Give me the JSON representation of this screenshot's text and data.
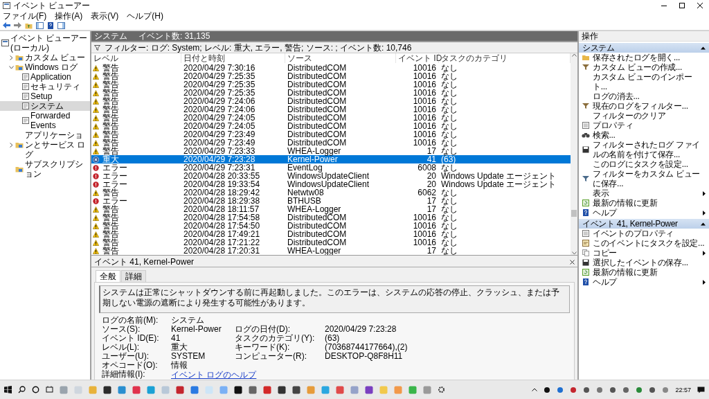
{
  "window": {
    "title": "イベント ビューアー"
  },
  "menu": [
    "ファイル(F)",
    "操作(A)",
    "表示(V)",
    "ヘルプ(H)"
  ],
  "tree": [
    {
      "label": "イベント ビューアー (ローカル)",
      "kind": "root",
      "selected": false,
      "children": [
        {
          "label": "カスタム ビュー",
          "kind": "folder",
          "expanded": false,
          "selected": false
        },
        {
          "label": "Windows ログ",
          "kind": "folder",
          "expanded": true,
          "selected": false,
          "children": [
            {
              "label": "Application",
              "kind": "log",
              "selected": false
            },
            {
              "label": "セキュリティ",
              "kind": "log",
              "selected": false
            },
            {
              "label": "Setup",
              "kind": "log",
              "selected": false
            },
            {
              "label": "システム",
              "kind": "log",
              "selected": true
            },
            {
              "label": "Forwarded Events",
              "kind": "log",
              "selected": false
            }
          ]
        },
        {
          "label": "アプリケーションとサービス ログ",
          "kind": "folder",
          "expanded": false,
          "selected": false
        },
        {
          "label": "サブスクリプション",
          "kind": "folder",
          "selected": false
        }
      ]
    }
  ],
  "log_header": {
    "title": "システム",
    "count": "イベント数: 31,135"
  },
  "filter": "フィルター: ログ: System; レベル: 重大, エラー, 警告; ソース: ; イベント数: 10,746",
  "table": {
    "columns": [
      "レベル",
      "日付と時刻",
      "ソース",
      "イベント ID",
      "タスクのカテゴリ"
    ],
    "rows": [
      {
        "kind": "warning",
        "level": "警告",
        "datetime": "2020/04/29 7:30:16",
        "source": "DistributedCOM",
        "event_id": "10016",
        "category": "なし",
        "selected": false
      },
      {
        "kind": "warning",
        "level": "警告",
        "datetime": "2020/04/29 7:25:35",
        "source": "DistributedCOM",
        "event_id": "10016",
        "category": "なし",
        "selected": false
      },
      {
        "kind": "warning",
        "level": "警告",
        "datetime": "2020/04/29 7:25:35",
        "source": "DistributedCOM",
        "event_id": "10016",
        "category": "なし",
        "selected": false
      },
      {
        "kind": "warning",
        "level": "警告",
        "datetime": "2020/04/29 7:25:35",
        "source": "DistributedCOM",
        "event_id": "10016",
        "category": "なし",
        "selected": false
      },
      {
        "kind": "warning",
        "level": "警告",
        "datetime": "2020/04/29 7:24:06",
        "source": "DistributedCOM",
        "event_id": "10016",
        "category": "なし",
        "selected": false
      },
      {
        "kind": "warning",
        "level": "警告",
        "datetime": "2020/04/29 7:24:06",
        "source": "DistributedCOM",
        "event_id": "10016",
        "category": "なし",
        "selected": false
      },
      {
        "kind": "warning",
        "level": "警告",
        "datetime": "2020/04/29 7:24:05",
        "source": "DistributedCOM",
        "event_id": "10016",
        "category": "なし",
        "selected": false
      },
      {
        "kind": "warning",
        "level": "警告",
        "datetime": "2020/04/29 7:24:05",
        "source": "DistributedCOM",
        "event_id": "10016",
        "category": "なし",
        "selected": false
      },
      {
        "kind": "warning",
        "level": "警告",
        "datetime": "2020/04/29 7:23:49",
        "source": "DistributedCOM",
        "event_id": "10016",
        "category": "なし",
        "selected": false
      },
      {
        "kind": "warning",
        "level": "警告",
        "datetime": "2020/04/29 7:23:49",
        "source": "DistributedCOM",
        "event_id": "10016",
        "category": "なし",
        "selected": false
      },
      {
        "kind": "warning",
        "level": "警告",
        "datetime": "2020/04/29 7:23:33",
        "source": "WHEA-Logger",
        "event_id": "17",
        "category": "なし",
        "selected": false
      },
      {
        "kind": "critical",
        "level": "重大",
        "datetime": "2020/04/29 7:23:28",
        "source": "Kernel-Power",
        "event_id": "41",
        "category": "(63)",
        "selected": true
      },
      {
        "kind": "error",
        "level": "エラー",
        "datetime": "2020/04/29 7:23:31",
        "source": "EventLog",
        "event_id": "6008",
        "category": "なし",
        "selected": false
      },
      {
        "kind": "error",
        "level": "エラー",
        "datetime": "2020/04/28 20:33:55",
        "source": "WindowsUpdateClient",
        "event_id": "20",
        "category": "Windows Update エージェント",
        "selected": false
      },
      {
        "kind": "error",
        "level": "エラー",
        "datetime": "2020/04/28 19:33:54",
        "source": "WindowsUpdateClient",
        "event_id": "20",
        "category": "Windows Update エージェント",
        "selected": false
      },
      {
        "kind": "warning",
        "level": "警告",
        "datetime": "2020/04/28 18:29:42",
        "source": "Netwtw08",
        "event_id": "6062",
        "category": "なし",
        "selected": false
      },
      {
        "kind": "error",
        "level": "エラー",
        "datetime": "2020/04/28 18:29:38",
        "source": "BTHUSB",
        "event_id": "17",
        "category": "なし",
        "selected": false
      },
      {
        "kind": "warning",
        "level": "警告",
        "datetime": "2020/04/28 18:11:57",
        "source": "WHEA-Logger",
        "event_id": "17",
        "category": "なし",
        "selected": false
      },
      {
        "kind": "warning",
        "level": "警告",
        "datetime": "2020/04/28 17:54:58",
        "source": "DistributedCOM",
        "event_id": "10016",
        "category": "なし",
        "selected": false
      },
      {
        "kind": "warning",
        "level": "警告",
        "datetime": "2020/04/28 17:54:50",
        "source": "DistributedCOM",
        "event_id": "10016",
        "category": "なし",
        "selected": false
      },
      {
        "kind": "warning",
        "level": "警告",
        "datetime": "2020/04/28 17:49:21",
        "source": "DistributedCOM",
        "event_id": "10016",
        "category": "なし",
        "selected": false
      },
      {
        "kind": "warning",
        "level": "警告",
        "datetime": "2020/04/28 17:21:22",
        "source": "DistributedCOM",
        "event_id": "10016",
        "category": "なし",
        "selected": false
      },
      {
        "kind": "warning",
        "level": "警告",
        "datetime": "2020/04/28 17:20:31",
        "source": "WHEA-Logger",
        "event_id": "17",
        "category": "なし",
        "selected": false
      }
    ]
  },
  "detail": {
    "title": "イベント 41, Kernel-Power",
    "tabs": [
      {
        "label": "全般",
        "selected": true
      },
      {
        "label": "詳細",
        "selected": false
      }
    ],
    "message": "システムは正常にシャットダウンする前に再起動しました。このエラーは、システムの応答の停止、クラッシュ、または予期しない電源の遮断により発生する可能性があります。",
    "fields_left": [
      {
        "label": "ログの名前(M):",
        "value": "システム",
        "kind": "text"
      },
      {
        "label": "ソース(S):",
        "value": "Kernel-Power",
        "kind": "text"
      },
      {
        "label": "イベント ID(E):",
        "value": "41",
        "kind": "text"
      },
      {
        "label": "レベル(L):",
        "value": "重大",
        "kind": "text"
      },
      {
        "label": "ユーザー(U):",
        "value": "SYSTEM",
        "kind": "text"
      },
      {
        "label": "オペコード(O):",
        "value": "情報",
        "kind": "text"
      },
      {
        "label": "詳細情報(I):",
        "value": "イベント ログのヘルプ",
        "kind": "link"
      }
    ],
    "fields_right": [
      {
        "label": "ログの日付(D):",
        "value": "2020/04/29 7:23:28"
      },
      {
        "label": "タスクのカテゴリ(Y):",
        "value": "(63)"
      },
      {
        "label": "キーワード(K):",
        "value": "(70368744177664),(2)"
      },
      {
        "label": "コンピューター(R):",
        "value": "DESKTOP-Q8F8H11"
      }
    ]
  },
  "actions": {
    "title": "操作",
    "sections": [
      {
        "title": "システム",
        "expanded": true,
        "items": [
          {
            "label": "保存されたログを開く...",
            "kind": "open",
            "submenu": false
          },
          {
            "label": "カスタム ビューの作成...",
            "kind": "filter",
            "submenu": false
          },
          {
            "label": "カスタム ビューのインポート...",
            "kind": "none",
            "submenu": false
          },
          {
            "label": "ログの消去...",
            "kind": "none",
            "submenu": false
          },
          {
            "label": "現在のログをフィルター...",
            "kind": "filter",
            "submenu": false
          },
          {
            "label": "フィルターのクリア",
            "kind": "none",
            "submenu": false
          },
          {
            "label": "プロパティ",
            "kind": "props",
            "submenu": false
          },
          {
            "label": "検索...",
            "kind": "find",
            "submenu": false
          },
          {
            "label": "フィルターされたログ ファイルの名前を付けて保存...",
            "kind": "save",
            "submenu": false
          },
          {
            "label": "このログにタスクを設定...",
            "kind": "none",
            "submenu": false
          },
          {
            "label": "フィルターをカスタム ビューに保存...",
            "kind": "filtersave",
            "submenu": false
          },
          {
            "label": "表示",
            "kind": "none",
            "submenu": true
          },
          {
            "label": "最新の情報に更新",
            "kind": "refresh",
            "submenu": false
          },
          {
            "label": "ヘルプ",
            "kind": "help",
            "submenu": true
          }
        ]
      },
      {
        "title": "イベント 41, Kernel-Power",
        "expanded": true,
        "items": [
          {
            "label": "イベントのプロパティ",
            "kind": "props",
            "submenu": false
          },
          {
            "label": "このイベントにタスクを設定...",
            "kind": "task",
            "submenu": false
          },
          {
            "label": "コピー",
            "kind": "copy",
            "submenu": true
          },
          {
            "label": "選択したイベントの保存...",
            "kind": "save",
            "submenu": false
          },
          {
            "label": "最新の情報に更新",
            "kind": "refresh",
            "submenu": false
          },
          {
            "label": "ヘルプ",
            "kind": "help",
            "submenu": true
          }
        ]
      }
    ]
  },
  "taskbar": {
    "time": "22:57"
  }
}
